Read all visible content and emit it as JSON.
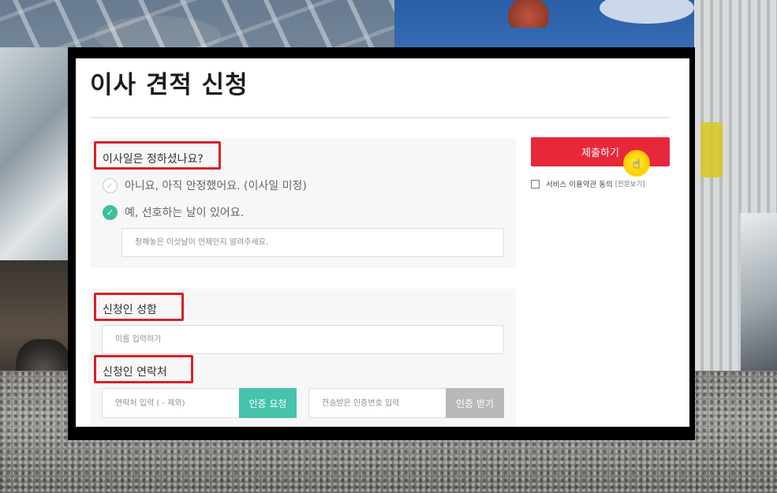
{
  "page": {
    "title": "이사 견적 신청"
  },
  "move_date": {
    "question": "이사일은 정하셨나요?",
    "options": [
      {
        "label": "아니요, 아직 안정했어요. (이사일 미정)",
        "selected": false
      },
      {
        "label": "예, 선호하는 날이 있어요.",
        "selected": true
      }
    ],
    "date_placeholder": "정해놓은 이삿날이 언제인지 알려주세요."
  },
  "applicant": {
    "name_label": "신청인 성함",
    "name_placeholder": "이름 입력하기",
    "contact_label": "신청인 연락처",
    "phone_placeholder": "연락처 입력 ( - 제외)",
    "request_code_label": "인증 요청",
    "code_placeholder": "전송받은 인증번호 입력",
    "receive_code_label": "인증 받기"
  },
  "submit": {
    "label": "제출하기",
    "agree_text": "서비스 이용약관 동의",
    "view_full": "[전문보기]"
  },
  "colors": {
    "submit": "#e8283a",
    "verify_request": "#45c3ab",
    "verify_receive": "#b9b9b9",
    "highlight_box": "#d92028",
    "check_selected": "#3cbf9c"
  }
}
